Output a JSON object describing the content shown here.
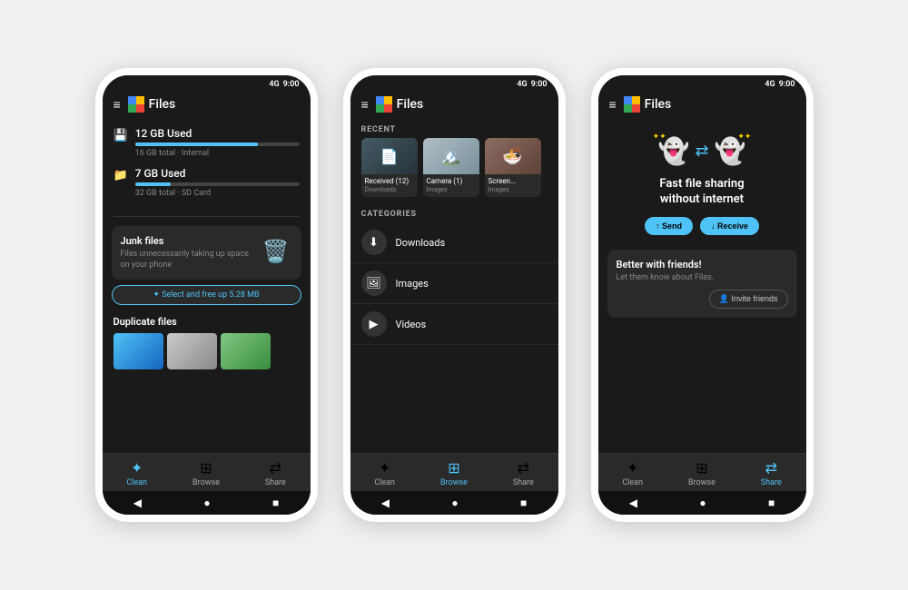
{
  "app": {
    "title": "Files",
    "status_bar": {
      "signal": "4G",
      "time": "9:00"
    }
  },
  "colors": {
    "accent": "#4fc3f7",
    "background": "#1a1a1a",
    "card": "#2a2a2a",
    "text_primary": "#ffffff",
    "text_secondary": "#888888",
    "gold": "#ffd700"
  },
  "screen1": {
    "tab": "Clean",
    "storage": [
      {
        "label": "12 GB Used",
        "bar_percent": 75,
        "subtitle": "16 GB total · Internal",
        "icon": "💾"
      },
      {
        "label": "7 GB Used",
        "bar_percent": 22,
        "subtitle": "32 GB total · SD Card",
        "icon": "📁"
      }
    ],
    "junk_card": {
      "title": "Junk files",
      "description": "Files unnecessarily taking up space on your phone",
      "icon": "🗑️"
    },
    "clean_button": "✦ Select and free up 5.28 MB",
    "duplicate_section": "Duplicate files"
  },
  "screen2": {
    "tab": "Browse",
    "recent_label": "RECENT",
    "categories_label": "CATEGORIES",
    "recent_items": [
      {
        "name": "Received (12)",
        "category": "Downloads",
        "type": "download"
      },
      {
        "name": "Camera (1)",
        "category": "Images",
        "type": "camera"
      },
      {
        "name": "Screen...",
        "category": "Images",
        "type": "screen"
      }
    ],
    "categories": [
      {
        "name": "Downloads",
        "icon": "⬇"
      },
      {
        "name": "Images",
        "icon": "🖼"
      },
      {
        "name": "Videos",
        "icon": "▶"
      }
    ]
  },
  "screen3": {
    "tab": "Share",
    "hero_title": "Fast file sharing\nwithout internet",
    "send_button": "↑ Send",
    "receive_button": "↓ Receive",
    "friends_card": {
      "title": "Better with friends!",
      "subtitle": "Let them know about Files.",
      "invite_button": "👤 Invite friends"
    }
  },
  "nav": {
    "items": [
      {
        "label": "Clean",
        "icon": "✦"
      },
      {
        "label": "Browse",
        "icon": "⊞"
      },
      {
        "label": "Share",
        "icon": "⇄"
      }
    ]
  },
  "system_nav": {
    "back": "◀",
    "home": "●",
    "recent": "■"
  }
}
